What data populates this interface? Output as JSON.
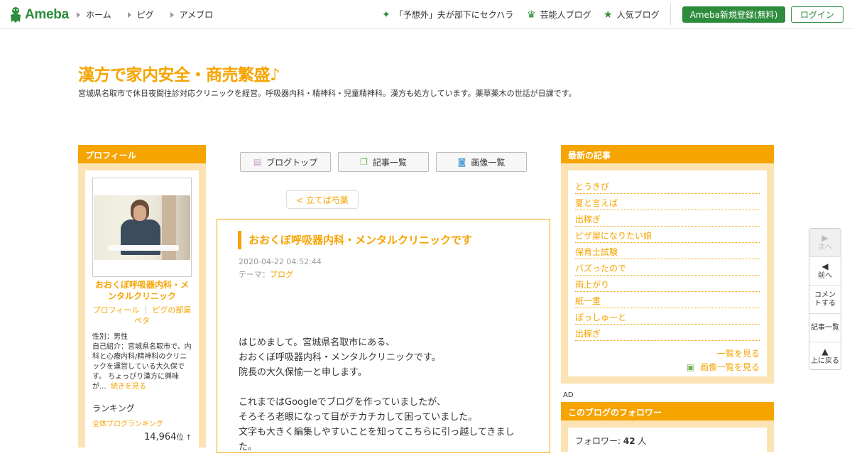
{
  "header": {
    "logo_text": "Ameba",
    "nav": [
      {
        "label": "ホーム"
      },
      {
        "label": "ピグ"
      },
      {
        "label": "アメブロ"
      }
    ],
    "trending": "「予想外」夫が部下にセクハラ",
    "celeb_blog": "芸能人ブログ",
    "popular_blog": "人気ブログ",
    "register_label": "Ameba新規登録(無料)",
    "login_label": "ログイン"
  },
  "blog": {
    "title": "漢方で家内安全・商売繁盛♪",
    "description": "宮城県名取市で休日夜間往診対応クリニックを経営。呼吸器内科・精神科・児童精神科。漢方も処方しています。薬草薬木の世話が日課です。"
  },
  "profile": {
    "heading": "プロフィール",
    "name": "おおくぼ呼吸器内科・メンタルクリニック",
    "link_profile": "プロフィール",
    "link_pig": "ピグの部屋",
    "link_peta": "ペタ",
    "gender": "性別：男性",
    "intro": "自己紹介：宮城県名取市で、内科と心療内科/精神科のクリニックを運営している大久保です。 ちょっぴり漢方に興味が...",
    "read_more": "続きを見る",
    "ranking_heading": "ランキング",
    "ranking_link": "全体ブログランキング",
    "ranking_value": "14,964",
    "ranking_unit": "位 ↑"
  },
  "center": {
    "blog_top": "ブログトップ",
    "article_list": "記事一覧",
    "image_list": "画像一覧",
    "prev_article": "< 立てば芍薬"
  },
  "article": {
    "title": "おおくぼ呼吸器内科・メンタルクリニックです",
    "date": "2020-04-22 04:52:44",
    "theme_label": "テーマ：",
    "theme": "ブログ",
    "body": [
      "はじめまして。宮城県名取市にある、",
      "おおくぼ呼吸器内科・メンタルクリニックです。",
      "院長の大久保愉一と申します。",
      "",
      "これまではGoogleでブログを作っていましたが、",
      "そろそろ老眼になって目がチカチカして困っていました。",
      "文字も大きく編集しやすいことを知ってこちらに引っ越してきました。"
    ]
  },
  "recent": {
    "heading": "最新の記事",
    "items": [
      {
        "label": "とうきび"
      },
      {
        "label": "夏と言えば"
      },
      {
        "label": "出稼ぎ"
      },
      {
        "label": "ピザ屋になりたい娘"
      },
      {
        "label": "保育士試験"
      },
      {
        "label": "バズったので"
      },
      {
        "label": "雨上がり"
      },
      {
        "label": "紙一重"
      },
      {
        "label": "ぽっしゅーと"
      },
      {
        "label": "出稼ぎ"
      }
    ],
    "see_all": "一覧を見る",
    "see_images": "画像一覧を見る"
  },
  "ad_label": "AD",
  "followers": {
    "heading": "このブログのフォロワー",
    "label": "フォロワー: ",
    "count": "42",
    "unit": " 人"
  },
  "sidenav": {
    "next": "次へ",
    "prev": "前へ",
    "comment": "コメントする",
    "article_list": "記事一覧",
    "to_top": "上に戻る"
  },
  "colors": {
    "brand_green": "#2d8c3c",
    "accent_orange": "#f5a400",
    "panel_bg": "#fce3b4"
  }
}
